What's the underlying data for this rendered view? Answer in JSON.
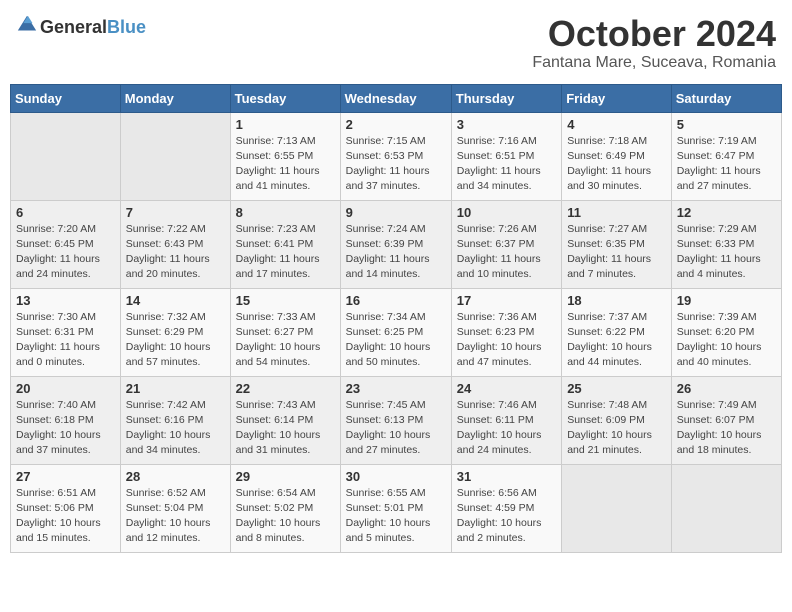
{
  "header": {
    "logo_general": "General",
    "logo_blue": "Blue",
    "month": "October 2024",
    "location": "Fantana Mare, Suceava, Romania"
  },
  "days_of_week": [
    "Sunday",
    "Monday",
    "Tuesday",
    "Wednesday",
    "Thursday",
    "Friday",
    "Saturday"
  ],
  "weeks": [
    [
      {
        "day": "",
        "info": ""
      },
      {
        "day": "",
        "info": ""
      },
      {
        "day": "1",
        "sunrise": "Sunrise: 7:13 AM",
        "sunset": "Sunset: 6:55 PM",
        "daylight": "Daylight: 11 hours and 41 minutes."
      },
      {
        "day": "2",
        "sunrise": "Sunrise: 7:15 AM",
        "sunset": "Sunset: 6:53 PM",
        "daylight": "Daylight: 11 hours and 37 minutes."
      },
      {
        "day": "3",
        "sunrise": "Sunrise: 7:16 AM",
        "sunset": "Sunset: 6:51 PM",
        "daylight": "Daylight: 11 hours and 34 minutes."
      },
      {
        "day": "4",
        "sunrise": "Sunrise: 7:18 AM",
        "sunset": "Sunset: 6:49 PM",
        "daylight": "Daylight: 11 hours and 30 minutes."
      },
      {
        "day": "5",
        "sunrise": "Sunrise: 7:19 AM",
        "sunset": "Sunset: 6:47 PM",
        "daylight": "Daylight: 11 hours and 27 minutes."
      }
    ],
    [
      {
        "day": "6",
        "sunrise": "Sunrise: 7:20 AM",
        "sunset": "Sunset: 6:45 PM",
        "daylight": "Daylight: 11 hours and 24 minutes."
      },
      {
        "day": "7",
        "sunrise": "Sunrise: 7:22 AM",
        "sunset": "Sunset: 6:43 PM",
        "daylight": "Daylight: 11 hours and 20 minutes."
      },
      {
        "day": "8",
        "sunrise": "Sunrise: 7:23 AM",
        "sunset": "Sunset: 6:41 PM",
        "daylight": "Daylight: 11 hours and 17 minutes."
      },
      {
        "day": "9",
        "sunrise": "Sunrise: 7:24 AM",
        "sunset": "Sunset: 6:39 PM",
        "daylight": "Daylight: 11 hours and 14 minutes."
      },
      {
        "day": "10",
        "sunrise": "Sunrise: 7:26 AM",
        "sunset": "Sunset: 6:37 PM",
        "daylight": "Daylight: 11 hours and 10 minutes."
      },
      {
        "day": "11",
        "sunrise": "Sunrise: 7:27 AM",
        "sunset": "Sunset: 6:35 PM",
        "daylight": "Daylight: 11 hours and 7 minutes."
      },
      {
        "day": "12",
        "sunrise": "Sunrise: 7:29 AM",
        "sunset": "Sunset: 6:33 PM",
        "daylight": "Daylight: 11 hours and 4 minutes."
      }
    ],
    [
      {
        "day": "13",
        "sunrise": "Sunrise: 7:30 AM",
        "sunset": "Sunset: 6:31 PM",
        "daylight": "Daylight: 11 hours and 0 minutes."
      },
      {
        "day": "14",
        "sunrise": "Sunrise: 7:32 AM",
        "sunset": "Sunset: 6:29 PM",
        "daylight": "Daylight: 10 hours and 57 minutes."
      },
      {
        "day": "15",
        "sunrise": "Sunrise: 7:33 AM",
        "sunset": "Sunset: 6:27 PM",
        "daylight": "Daylight: 10 hours and 54 minutes."
      },
      {
        "day": "16",
        "sunrise": "Sunrise: 7:34 AM",
        "sunset": "Sunset: 6:25 PM",
        "daylight": "Daylight: 10 hours and 50 minutes."
      },
      {
        "day": "17",
        "sunrise": "Sunrise: 7:36 AM",
        "sunset": "Sunset: 6:23 PM",
        "daylight": "Daylight: 10 hours and 47 minutes."
      },
      {
        "day": "18",
        "sunrise": "Sunrise: 7:37 AM",
        "sunset": "Sunset: 6:22 PM",
        "daylight": "Daylight: 10 hours and 44 minutes."
      },
      {
        "day": "19",
        "sunrise": "Sunrise: 7:39 AM",
        "sunset": "Sunset: 6:20 PM",
        "daylight": "Daylight: 10 hours and 40 minutes."
      }
    ],
    [
      {
        "day": "20",
        "sunrise": "Sunrise: 7:40 AM",
        "sunset": "Sunset: 6:18 PM",
        "daylight": "Daylight: 10 hours and 37 minutes."
      },
      {
        "day": "21",
        "sunrise": "Sunrise: 7:42 AM",
        "sunset": "Sunset: 6:16 PM",
        "daylight": "Daylight: 10 hours and 34 minutes."
      },
      {
        "day": "22",
        "sunrise": "Sunrise: 7:43 AM",
        "sunset": "Sunset: 6:14 PM",
        "daylight": "Daylight: 10 hours and 31 minutes."
      },
      {
        "day": "23",
        "sunrise": "Sunrise: 7:45 AM",
        "sunset": "Sunset: 6:13 PM",
        "daylight": "Daylight: 10 hours and 27 minutes."
      },
      {
        "day": "24",
        "sunrise": "Sunrise: 7:46 AM",
        "sunset": "Sunset: 6:11 PM",
        "daylight": "Daylight: 10 hours and 24 minutes."
      },
      {
        "day": "25",
        "sunrise": "Sunrise: 7:48 AM",
        "sunset": "Sunset: 6:09 PM",
        "daylight": "Daylight: 10 hours and 21 minutes."
      },
      {
        "day": "26",
        "sunrise": "Sunrise: 7:49 AM",
        "sunset": "Sunset: 6:07 PM",
        "daylight": "Daylight: 10 hours and 18 minutes."
      }
    ],
    [
      {
        "day": "27",
        "sunrise": "Sunrise: 6:51 AM",
        "sunset": "Sunset: 5:06 PM",
        "daylight": "Daylight: 10 hours and 15 minutes."
      },
      {
        "day": "28",
        "sunrise": "Sunrise: 6:52 AM",
        "sunset": "Sunset: 5:04 PM",
        "daylight": "Daylight: 10 hours and 12 minutes."
      },
      {
        "day": "29",
        "sunrise": "Sunrise: 6:54 AM",
        "sunset": "Sunset: 5:02 PM",
        "daylight": "Daylight: 10 hours and 8 minutes."
      },
      {
        "day": "30",
        "sunrise": "Sunrise: 6:55 AM",
        "sunset": "Sunset: 5:01 PM",
        "daylight": "Daylight: 10 hours and 5 minutes."
      },
      {
        "day": "31",
        "sunrise": "Sunrise: 6:56 AM",
        "sunset": "Sunset: 4:59 PM",
        "daylight": "Daylight: 10 hours and 2 minutes."
      },
      {
        "day": "",
        "info": ""
      },
      {
        "day": "",
        "info": ""
      }
    ]
  ]
}
